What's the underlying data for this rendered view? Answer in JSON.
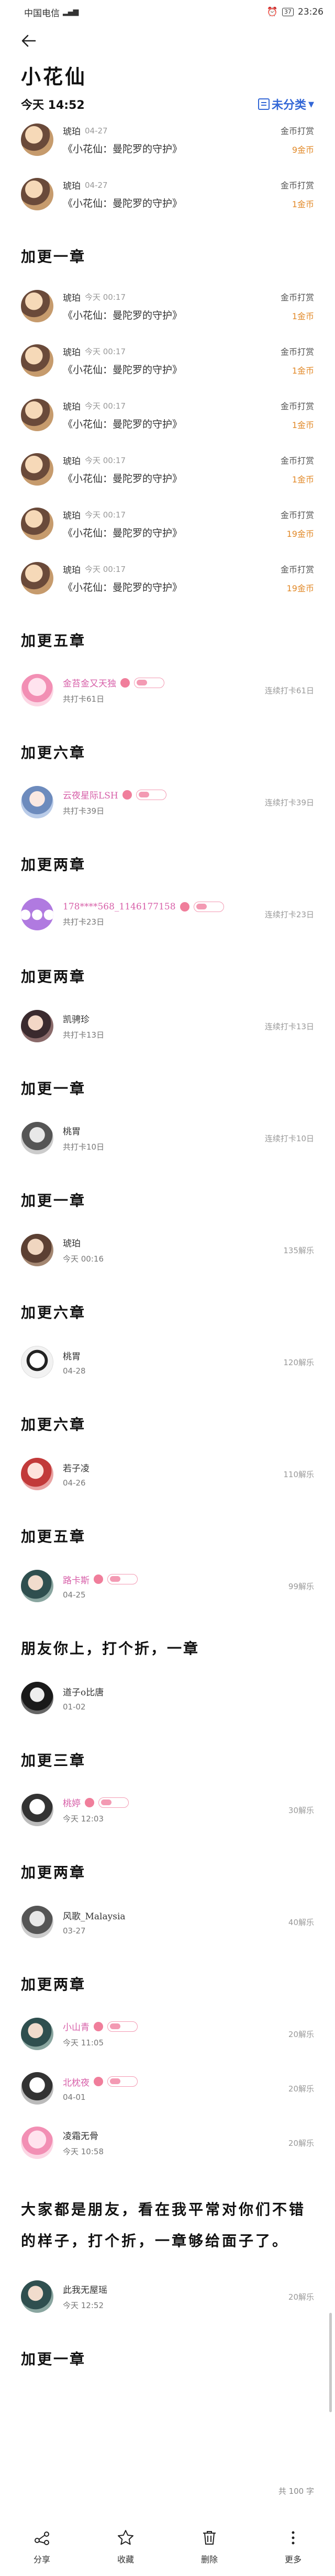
{
  "status_bar": {
    "carrier": "中国电信",
    "battery": "37",
    "time": "23:26"
  },
  "page": {
    "title": "小花仙",
    "date_label": "今天 14:52",
    "category": "未分类"
  },
  "top_rewards": [
    {
      "name": "琥珀",
      "date": "04-27",
      "item": "《小花仙：曼陀罗的守护》",
      "label": "金币打赏",
      "amount": "9金币"
    },
    {
      "name": "琥珀",
      "date": "04-27",
      "item": "《小花仙：曼陀罗的守护》",
      "label": "金币打赏",
      "amount": "1金币"
    }
  ],
  "sections": [
    {
      "title": "加更一章",
      "rewards": [
        {
          "name": "琥珀",
          "date": "今天 00:17",
          "item": "《小花仙：曼陀罗的守护》",
          "label": "金币打赏",
          "amount": "1金币"
        },
        {
          "name": "琥珀",
          "date": "今天 00:17",
          "item": "《小花仙：曼陀罗的守护》",
          "label": "金币打赏",
          "amount": "1金币"
        },
        {
          "name": "琥珀",
          "date": "今天 00:17",
          "item": "《小花仙：曼陀罗的守护》",
          "label": "金币打赏",
          "amount": "1金币"
        },
        {
          "name": "琥珀",
          "date": "今天 00:17",
          "item": "《小花仙：曼陀罗的守护》",
          "label": "金币打赏",
          "amount": "1金币"
        },
        {
          "name": "琥珀",
          "date": "今天 00:17",
          "item": "《小花仙：曼陀罗的守护》",
          "label": "金币打赏",
          "amount": "19金币"
        },
        {
          "name": "琥珀",
          "date": "今天 00:17",
          "item": "《小花仙：曼陀罗的守护》",
          "label": "金币打赏",
          "amount": "19金币"
        }
      ]
    },
    {
      "title": "加更五章",
      "user": {
        "name": "金苔金又天独",
        "sub": "共打卡61日",
        "note": "连续打卡61日"
      }
    },
    {
      "title": "加更六章",
      "user": {
        "name": "云夜星际LSH",
        "sub": "共打卡39日",
        "note": "连续打卡39日"
      }
    },
    {
      "title": "加更两章",
      "user": {
        "name": "178****568_1146177158",
        "sub": "共打卡23日",
        "note": "连续打卡23日"
      }
    },
    {
      "title": "加更两章",
      "user": {
        "name": "凯骋珍",
        "sub": "共打卡13日",
        "note": "连续打卡13日"
      }
    },
    {
      "title": "加更一章",
      "user": {
        "name": "桃胃",
        "sub": "共打卡10日",
        "note": "连续打卡10日"
      }
    },
    {
      "title": "加更一章",
      "user": {
        "name": "琥珀",
        "sub": "今天 00:16",
        "note": "135解乐"
      }
    },
    {
      "title": "加更六章",
      "user": {
        "name": "桃胃",
        "sub": "04-28",
        "note": "120解乐"
      }
    },
    {
      "title": "加更六章",
      "user": {
        "name": "若子凌",
        "sub": "04-26",
        "note": "110解乐"
      }
    },
    {
      "title": "加更五章",
      "user": {
        "name": "路卡斯",
        "sub": "04-25",
        "note": "99解乐"
      }
    },
    {
      "title": "朋友你上，打个折，一章",
      "user": {
        "name": "道子o比唐",
        "sub": "01-02",
        "note": ""
      }
    },
    {
      "title": "加更三章",
      "user": {
        "name": "桃婷",
        "sub": "今天 12:03",
        "note": "30解乐"
      }
    },
    {
      "title": "加更两章",
      "user": {
        "name": "风歌_Malaysia",
        "sub": "03-27",
        "note": "40解乐"
      }
    },
    {
      "title": "加更两章",
      "users": [
        {
          "name": "小山青",
          "sub": "今天 11:05",
          "note": "20解乐"
        },
        {
          "name": "北枕夜",
          "sub": "04-01",
          "note": "20解乐"
        },
        {
          "name": "凌霜无骨",
          "sub": "今天 10:58",
          "note": "20解乐"
        }
      ]
    },
    {
      "title": "大家都是朋友，看在我平常对你们不错的样子，打个折，一章够给面子了。",
      "user": {
        "name": "此我无屋瑶",
        "sub": "今天 12:52",
        "note": "20解乐"
      }
    },
    {
      "title": "加更一章"
    }
  ],
  "footer": {
    "count": "共 100 字"
  },
  "nav": [
    {
      "label": "分享",
      "icon": "share-icon"
    },
    {
      "label": "收藏",
      "icon": "star-icon"
    },
    {
      "label": "删除",
      "icon": "trash-icon"
    },
    {
      "label": "更多",
      "icon": "more-icon"
    }
  ]
}
